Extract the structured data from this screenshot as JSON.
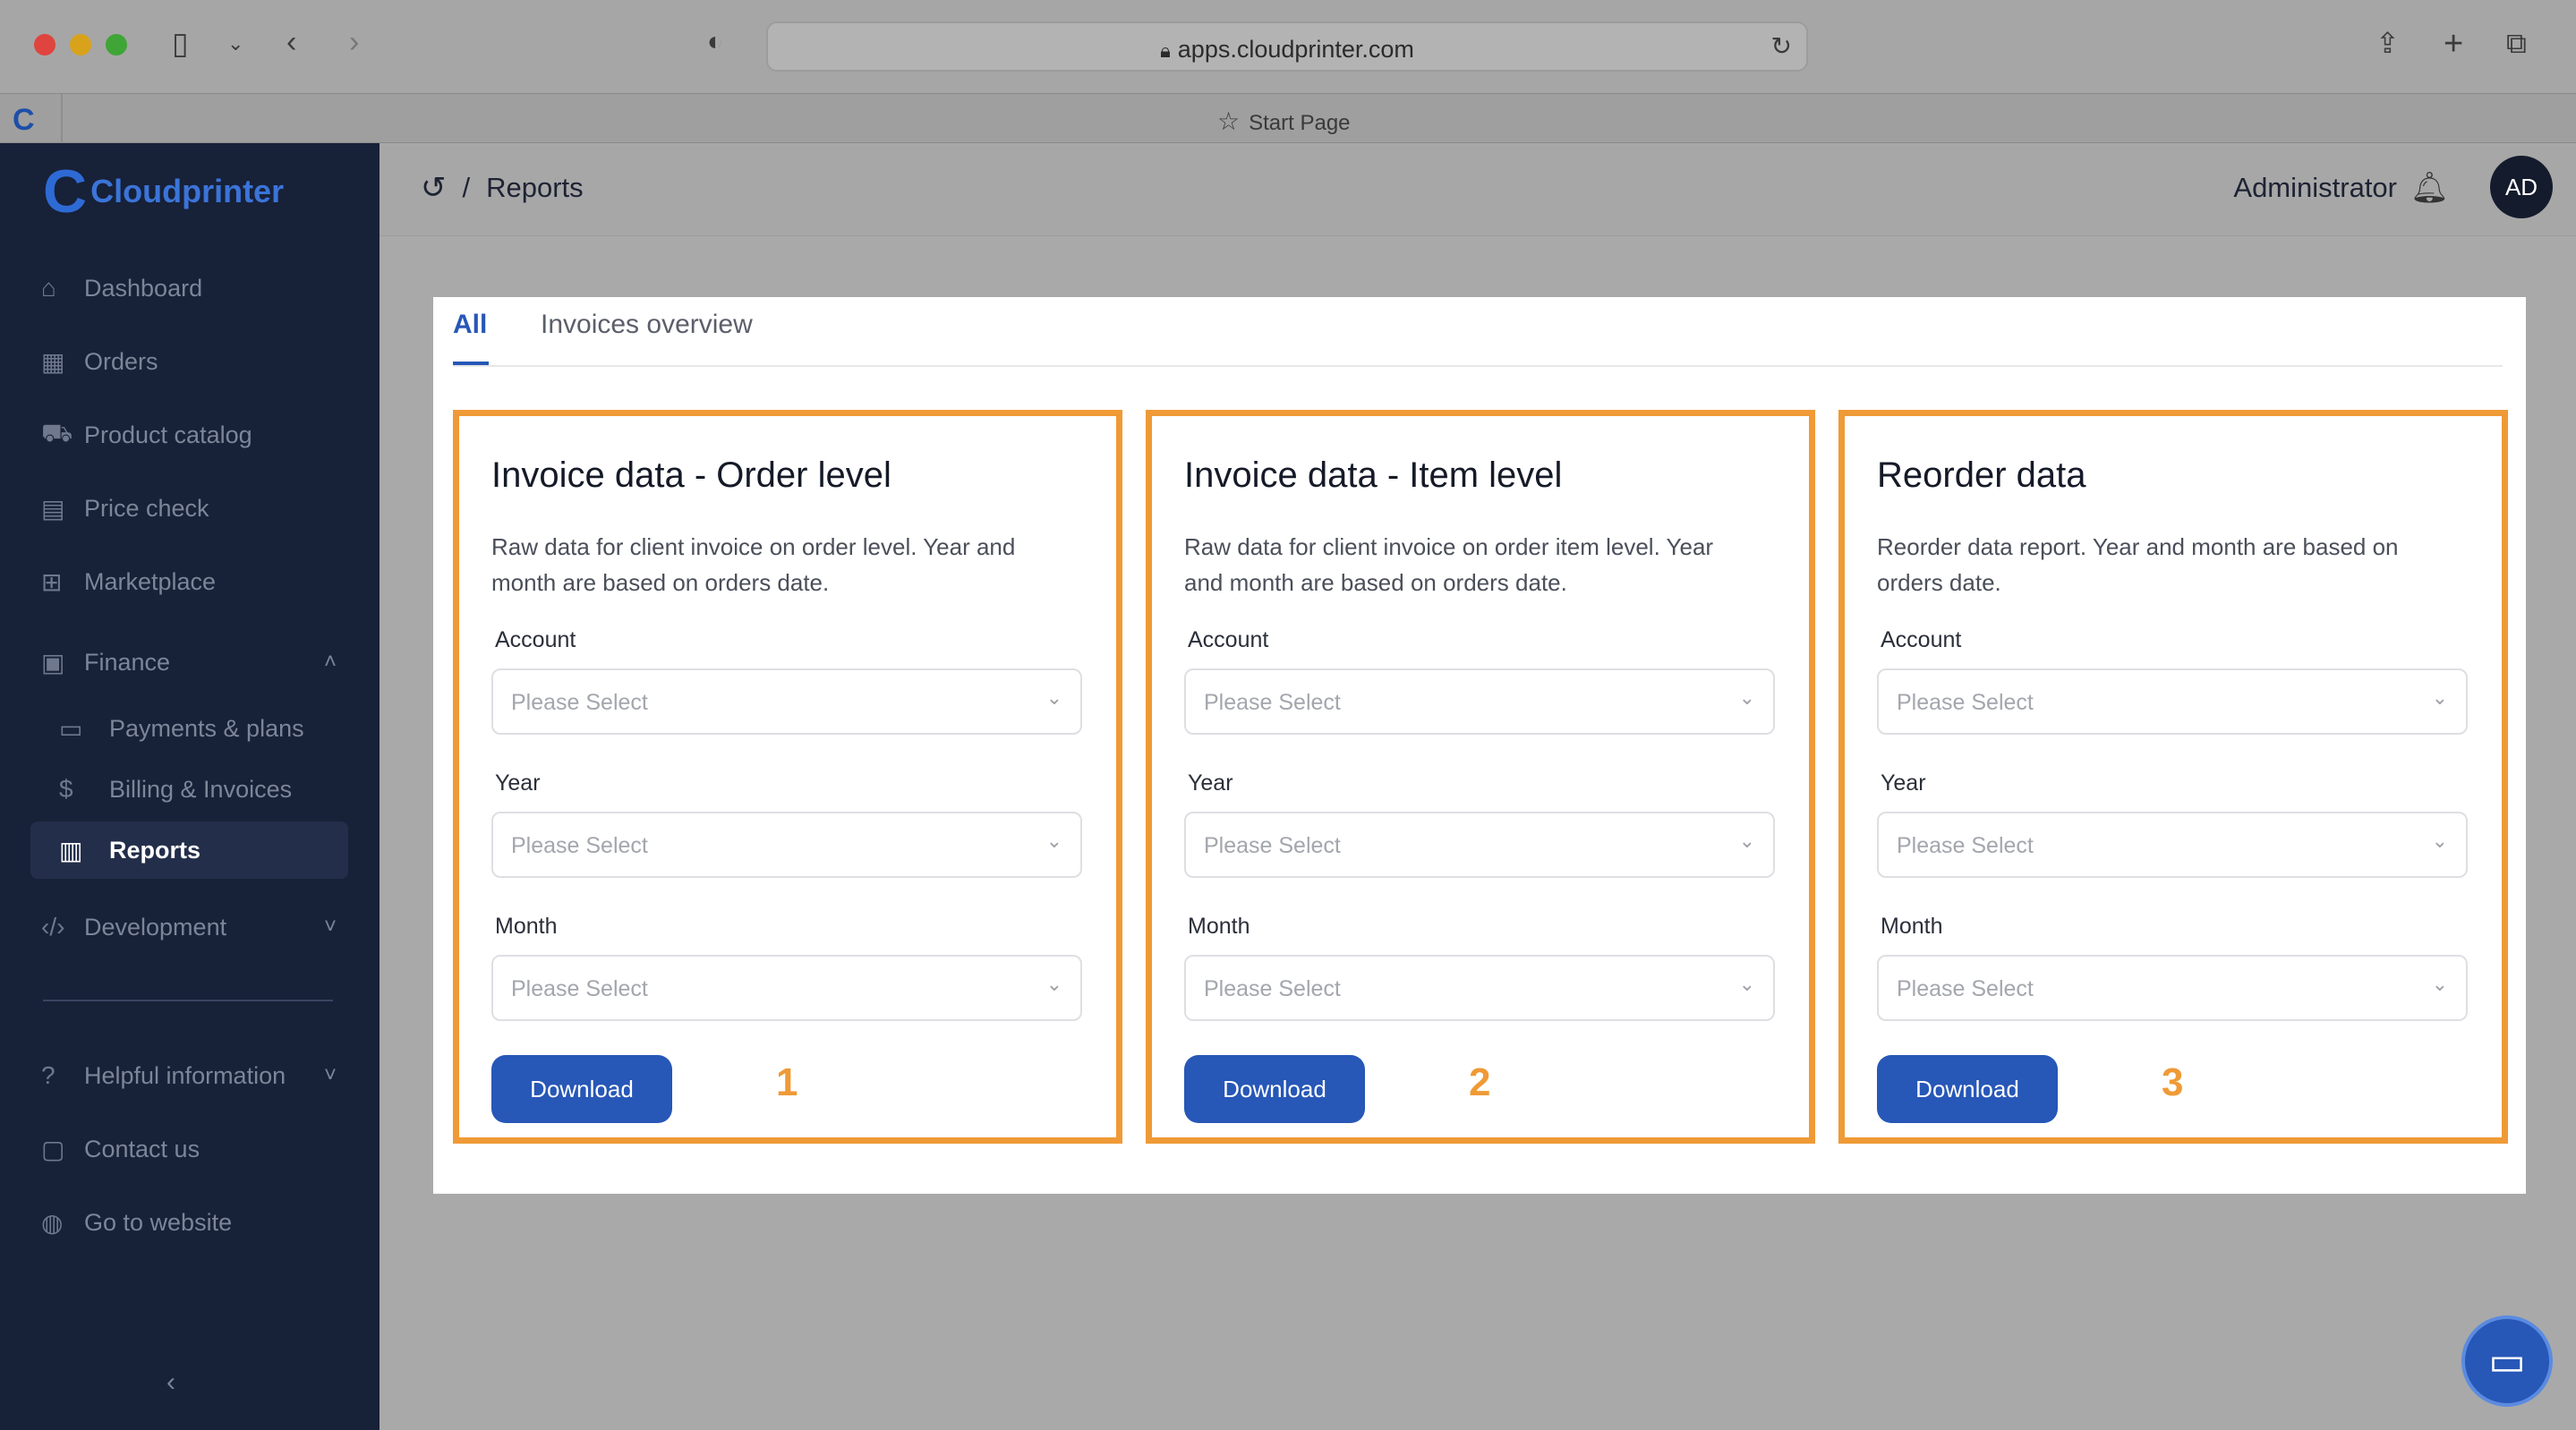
{
  "browser": {
    "url": "apps.cloudprinter.com",
    "tab_title": "Start Page"
  },
  "sidebar": {
    "logo_text": "Cloudprinter",
    "items": [
      {
        "label": "Dashboard",
        "icon": "home-icon"
      },
      {
        "label": "Orders",
        "icon": "orders-icon"
      },
      {
        "label": "Product catalog",
        "icon": "catalog-icon"
      },
      {
        "label": "Price check",
        "icon": "calculator-icon"
      },
      {
        "label": "Marketplace",
        "icon": "marketplace-icon"
      },
      {
        "label": "Finance",
        "icon": "finance-icon",
        "expanded": true
      },
      {
        "label": "Payments & plans",
        "icon": "card-icon"
      },
      {
        "label": "Billing & Invoices",
        "icon": "dollar-icon"
      },
      {
        "label": "Reports",
        "icon": "clipboard-icon",
        "active": true
      },
      {
        "label": "Development",
        "icon": "code-icon"
      },
      {
        "label": "Helpful information",
        "icon": "help-icon"
      },
      {
        "label": "Contact us",
        "icon": "chat-icon"
      },
      {
        "label": "Go to website",
        "icon": "globe-icon"
      }
    ]
  },
  "header": {
    "breadcrumb_sep": "/",
    "breadcrumb_page": "Reports",
    "user_name": "Administrator",
    "avatar_initials": "AD"
  },
  "tabs": [
    {
      "label": "All",
      "active": true
    },
    {
      "label": "Invoices overview",
      "active": false
    }
  ],
  "cards": [
    {
      "title": "Invoice data - Order level",
      "description": "Raw data for client invoice on order level. Year and month are based on orders date.",
      "fields": [
        {
          "label": "Account",
          "placeholder": "Please Select"
        },
        {
          "label": "Year",
          "placeholder": "Please Select"
        },
        {
          "label": "Month",
          "placeholder": "Please Select"
        }
      ],
      "button": "Download",
      "number": "1"
    },
    {
      "title": "Invoice data - Item level",
      "description": "Raw data for client invoice on order item level. Year and month are based on orders date.",
      "fields": [
        {
          "label": "Account",
          "placeholder": "Please Select"
        },
        {
          "label": "Year",
          "placeholder": "Please Select"
        },
        {
          "label": "Month",
          "placeholder": "Please Select"
        }
      ],
      "button": "Download",
      "number": "2"
    },
    {
      "title": "Reorder data",
      "description": "Reorder data report. Year and month are based on orders date.",
      "fields": [
        {
          "label": "Account",
          "placeholder": "Please Select"
        },
        {
          "label": "Year",
          "placeholder": "Please Select"
        },
        {
          "label": "Month",
          "placeholder": "Please Select"
        }
      ],
      "button": "Download",
      "number": "3"
    }
  ],
  "colors": {
    "accent": "#2757b7",
    "highlight": "#ef9a36",
    "sidebar_bg": "#172138"
  }
}
